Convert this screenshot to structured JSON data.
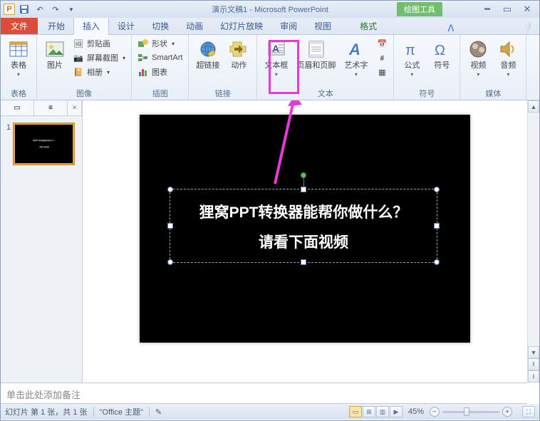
{
  "titlebar": {
    "title": "演示文稿1 - Microsoft PowerPoint",
    "context_tool": "绘图工具"
  },
  "tabs": {
    "file": "文件",
    "home": "开始",
    "insert": "插入",
    "design": "设计",
    "transition": "切换",
    "animate": "动画",
    "slideshow": "幻灯片放映",
    "review": "审阅",
    "view": "视图",
    "format": "格式"
  },
  "ribbon": {
    "groups": {
      "tables": "表格",
      "image": "图像",
      "illustration": "插图",
      "link": "链接",
      "text": "文本",
      "symbol": "符号",
      "media": "媒体"
    },
    "buttons": {
      "table": "表格",
      "picture": "图片",
      "clipart": "剪贴画",
      "screenshot": "屏幕截图",
      "album": "相册",
      "shapes": "形状",
      "smartart": "SmartArt",
      "chart": "图表",
      "hyperlink": "超链接",
      "action": "动作",
      "textbox": "文本框",
      "headerfooter": "页眉和页脚",
      "wordart": "艺术字",
      "equation": "公式",
      "symbol": "符号",
      "video": "视频",
      "audio": "音频"
    }
  },
  "thumb": {
    "num": "1"
  },
  "slide": {
    "line1": "狸窝PPT转换器能帮你做什么？",
    "line2": "请看下面视频"
  },
  "notes": {
    "placeholder": "单击此处添加备注"
  },
  "status": {
    "slide_info": "幻灯片 第 1 张，共 1 张",
    "theme": "\"Office 主题\"",
    "zoom": "45%"
  }
}
